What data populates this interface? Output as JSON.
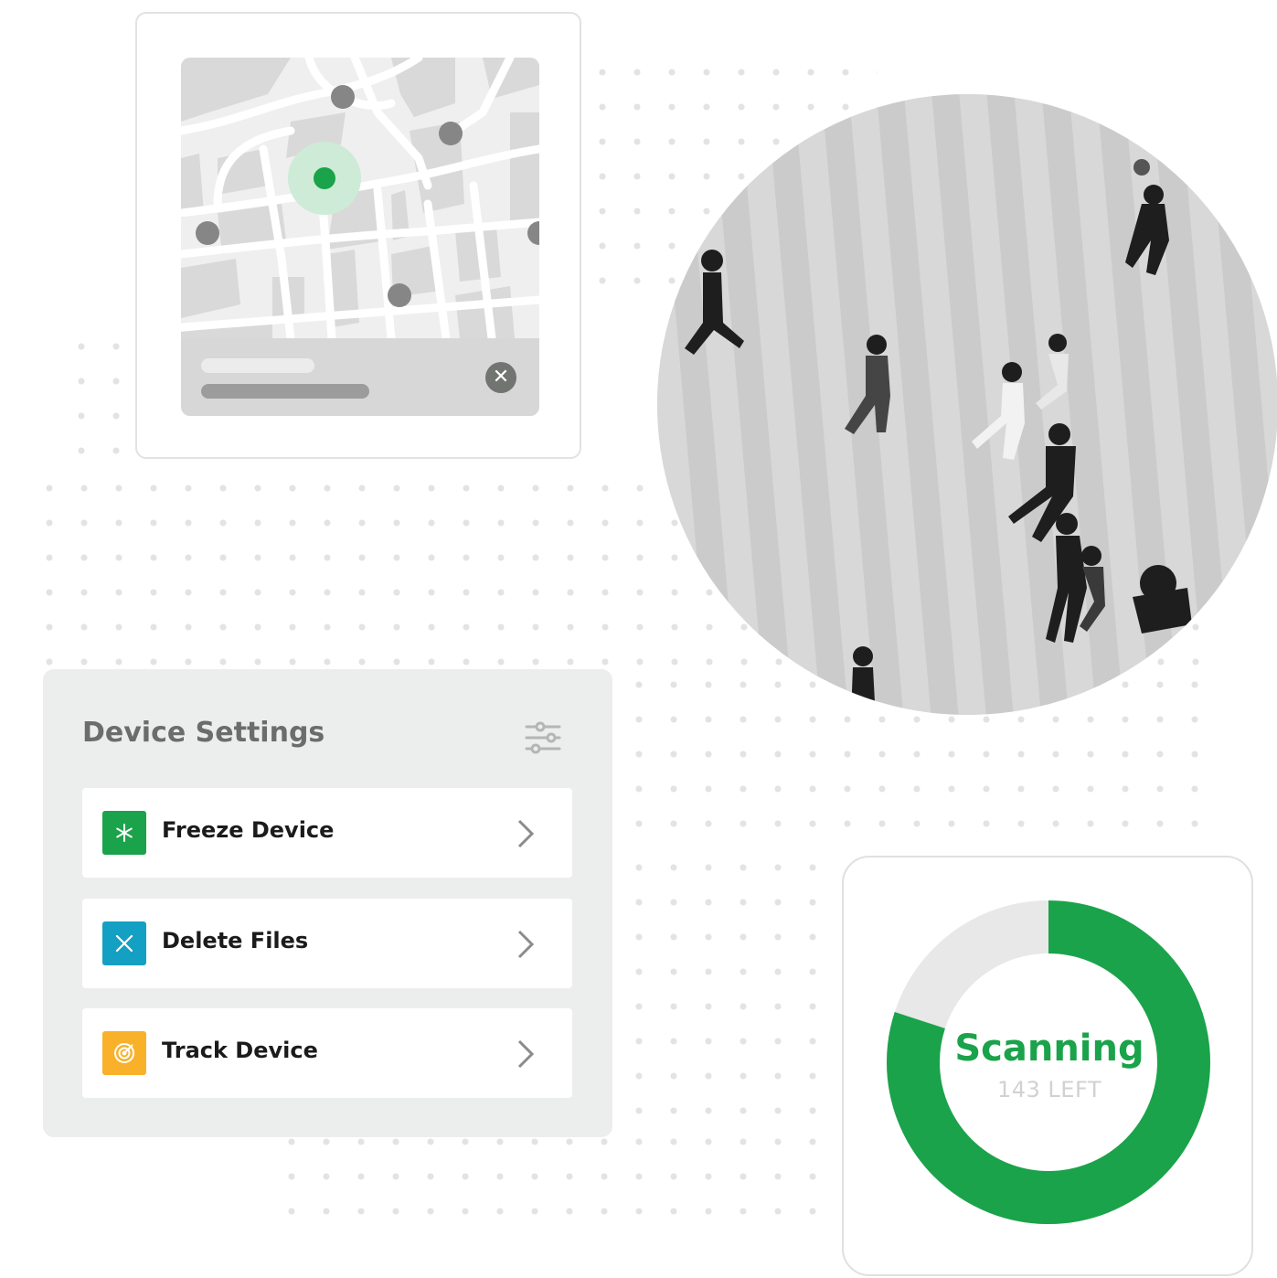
{
  "map_card": {
    "close_icon": "close-icon",
    "colors": {
      "accent": "#1aa34a",
      "pin": "#858685",
      "halo": "#cdebd6"
    }
  },
  "photo": {
    "description_icon": "crowd-photo",
    "style": "grayscale"
  },
  "settings": {
    "title": "Device Settings",
    "filter_icon": "sliders-icon",
    "items": [
      {
        "label": "Freeze Device",
        "icon": "snowflake-icon",
        "color": "#1aa34a"
      },
      {
        "label": "Delete Files",
        "icon": "x-icon",
        "color": "#13a0c3"
      },
      {
        "label": "Track Device",
        "icon": "target-icon",
        "color": "#f9b12a"
      }
    ]
  },
  "scan": {
    "status": "Scanning",
    "remaining": "143 LEFT",
    "progress": 0.8,
    "colors": {
      "progress": "#1aa34a",
      "track": "#e7e8e7"
    }
  }
}
